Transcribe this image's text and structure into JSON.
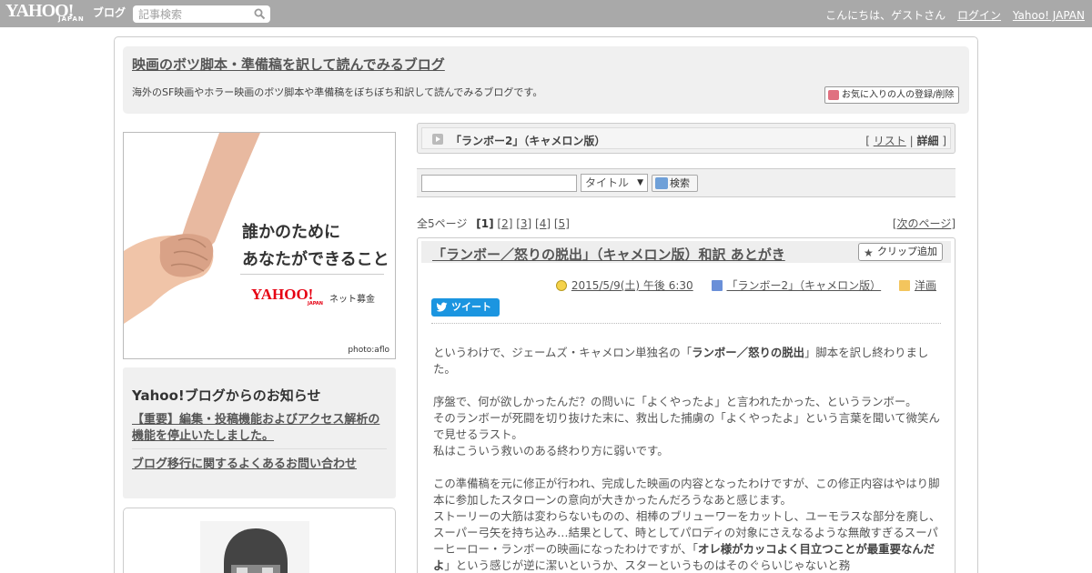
{
  "topbar": {
    "logo_yahoo": "YAHOO!",
    "logo_japan": "JAPAN",
    "logo_blog": "ブログ",
    "search_placeholder": "記事検索",
    "greeting": "こんにちは、ゲストさん",
    "login": "ログイン",
    "yahoo_japan": "Yahoo! JAPAN"
  },
  "blog": {
    "title": "映画のボツ脚本・準備稿を訳して読んでみるブログ",
    "description": "海外のSF映画やホラー映画のボツ脚本や準備稿をぼちぼち和訳して読んでみるブログです。",
    "favorite_button": "お気に入りの人の登録/削除"
  },
  "ad": {
    "line1": "誰かのために",
    "line2": "あなたができること",
    "brand": "YAHOO!",
    "brand_japan": "JAPAN",
    "service": "ネット募金",
    "credit": "photo:aflo"
  },
  "notice": {
    "title": "Yahoo!ブログからのお知らせ",
    "link1": "【重要】編集・投稿機能およびアクセス解析の機能を停止いたしました。",
    "link2": "ブログ移行に関するよくあるお問い合わせ"
  },
  "category": {
    "name": "「ランボー2」（キャメロン版）",
    "bracket_open": "[",
    "list": "リスト",
    "sep": "|",
    "detail": "詳細",
    "bracket_close": "]"
  },
  "search": {
    "select_value": "タイトル",
    "button": "検索"
  },
  "pager": {
    "label": "全5ページ",
    "current": "[1]",
    "pages": [
      "[2]",
      "[3]",
      "[4]",
      "[5]"
    ],
    "next_open": "[",
    "next": "次のページ",
    "next_close": "]"
  },
  "article": {
    "title": "「ランボー／怒りの脱出」（キャメロン版）和訳 あとがき",
    "clip_button": "クリップ追加",
    "date": "2015/5/9(土) 午後 6:30",
    "category": "「ランボー2」（キャメロン版）",
    "genre": "洋画",
    "tweet": "ツイート",
    "p1_a": "というわけで、ジェームズ・キャメロン単独名の「",
    "p1_b": "ランボー／怒りの脱出",
    "p1_c": "」脚本を訳し終わりました。",
    "p2_1": "序盤で、何が欲しかったんだ？の問いに「よくやったよ」と言われたかった、というランボー。",
    "p2_2": "そのランボーが死闘を切り抜けた末に、救出した捕虜の「よくやったよ」という言葉を聞いて微笑んで見せるラスト。",
    "p2_3": "私はこういう救いのある終わり方に弱いです。",
    "p3_1": "この準備稿を元に修正が行われ、完成した映画の内容となったわけですが、この修正内容はやはり脚本に参加したスタローンの意向が大きかったんだろうなあと感じます。",
    "p3_2": "ストーリーの大筋は変わらないものの、相棒のブリューワーをカットし、ユーモラスな部分を廃し、スーパー弓矢を持ち込み…結果として、時としてパロディの対象にさえなるような無敵すぎるスーパーヒーロー・ランボーの映画になったわけですが、「",
    "p3_bold": "オレ様がカッコよく目立つことが最重要なんだよ",
    "p3_3": "」という感じが逆に潔いというか、スターというものはそのぐらいじゃないと務"
  }
}
